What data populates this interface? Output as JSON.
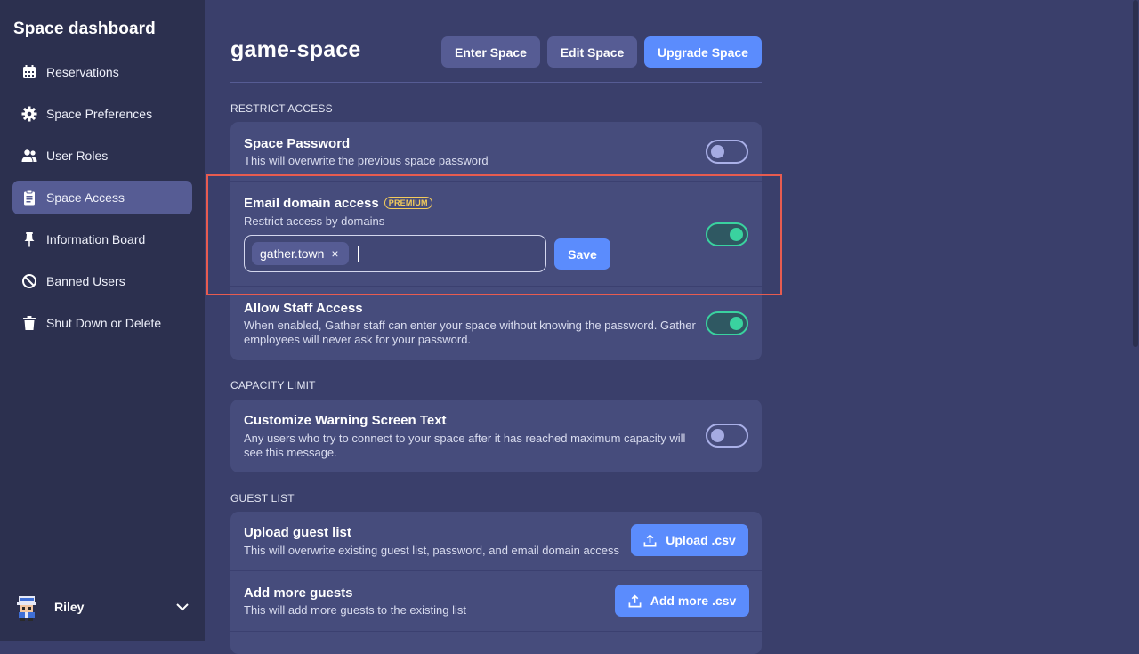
{
  "sidebar": {
    "title": "Space dashboard",
    "items": [
      {
        "label": "Reservations",
        "icon": "calendar-icon"
      },
      {
        "label": "Space Preferences",
        "icon": "gear-icon"
      },
      {
        "label": "User Roles",
        "icon": "users-icon"
      },
      {
        "label": "Space Access",
        "icon": "clipboard-icon",
        "active": true
      },
      {
        "label": "Information Board",
        "icon": "pin-icon"
      },
      {
        "label": "Banned Users",
        "icon": "ban-icon"
      },
      {
        "label": "Shut Down or Delete",
        "icon": "trash-icon"
      }
    ],
    "user": {
      "name": "Riley"
    }
  },
  "header": {
    "title": "game-space",
    "enter_label": "Enter Space",
    "edit_label": "Edit Space",
    "upgrade_label": "Upgrade Space"
  },
  "restrict_access": {
    "heading": "RESTRICT ACCESS",
    "password": {
      "title": "Space Password",
      "desc": "This will overwrite the previous space password",
      "enabled": false
    },
    "email_domain": {
      "title": "Email domain access",
      "badge": "PREMIUM",
      "desc": "Restrict access by domains",
      "chip": "gather.town",
      "chip_remove": "×",
      "save_label": "Save",
      "enabled": true
    },
    "staff": {
      "title": "Allow Staff Access",
      "desc": "When enabled, Gather staff can enter your space without knowing the password. Gather employees will never ask for your password.",
      "enabled": true
    }
  },
  "capacity": {
    "heading": "CAPACITY LIMIT",
    "warning": {
      "title": "Customize Warning Screen Text",
      "desc": "Any users who try to connect to your space after it has reached maximum capacity will see this message.",
      "enabled": false
    }
  },
  "guest_list": {
    "heading": "GUEST LIST",
    "upload": {
      "title": "Upload guest list",
      "desc": "This will overwrite existing guest list, password, and email domain access",
      "button": "Upload .csv"
    },
    "add": {
      "title": "Add more guests",
      "desc": "This will add more guests to the existing list",
      "button": "Add more .csv"
    }
  },
  "colors": {
    "accent": "#5b8cfd",
    "toggle_on": "#3ad29f",
    "highlight": "#e85c50",
    "badge": "#f5cc5a"
  }
}
